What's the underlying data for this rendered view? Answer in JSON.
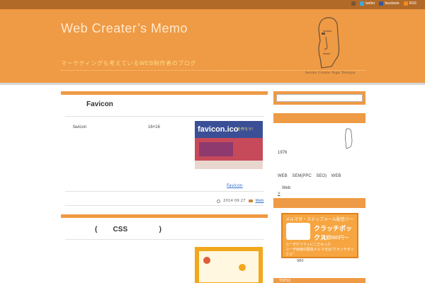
{
  "topbar": {
    "links": [
      {
        "label": "",
        "icon": "user-icon",
        "color": "#7a5533"
      },
      {
        "label": "twitter",
        "icon": "twitter-icon",
        "color": "#39a9e0"
      },
      {
        "label": "facebook",
        "icon": "facebook-icon",
        "color": "#3b5998"
      },
      {
        "label": "RSS",
        "icon": "rss-icon",
        "color": "#f08a24"
      }
    ]
  },
  "header": {
    "title": "Web Creater’s Memo",
    "tagline": "マーケティングも考えているWEB制作者のブログ",
    "caption": "Sendo Create Yogo Tomoya"
  },
  "articles": [
    {
      "title": "Favicon",
      "cells": [
        "favicon",
        "16×16"
      ],
      "thumb_title": "favicon.ico",
      "thumb_cta": "を作ろう!",
      "more": "Favicon",
      "date": "2014 09 27",
      "category": "Web"
    },
    {
      "title": "(        CSS                )"
    }
  ],
  "sidebar": {
    "search_placeholder": "",
    "profile": {
      "year": "1976",
      "skills": "WEB    SEM(PPC    SEO)    WEB",
      "more_line1": "Web",
      "more_line2": ">"
    },
    "banner": {
      "line1": "メルマガ・ステップメール配信ツール",
      "line2": "クラッチポックス",
      "line3": "月額980円〜",
      "line4a": "ユーザビリティにこだわった",
      "line4b": "ユーザ目線の配信メルマガは\"クラッチボックス\"",
      "count": "980"
    },
    "bottom_title": "TOP10"
  },
  "colors": {
    "header": "#ef9a45",
    "topbar": "#b26a28",
    "accent_link": "#2f6fcf"
  }
}
